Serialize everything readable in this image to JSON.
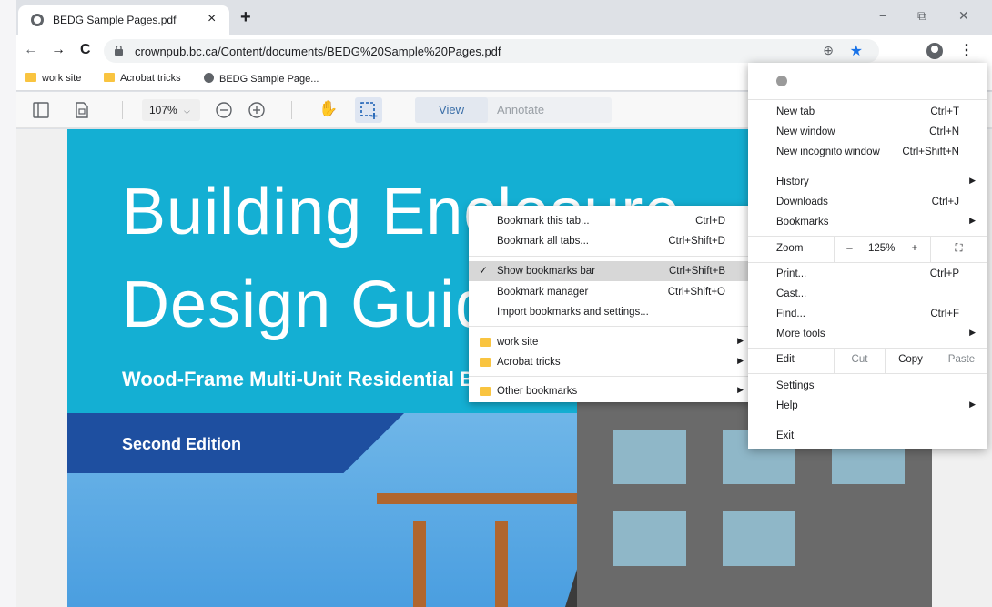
{
  "browser": {
    "tab_title": "BEDG Sample Pages.pdf",
    "tab_close": "×",
    "new_tab": "+",
    "window_controls": [
      "−",
      "⧉",
      "✕"
    ],
    "nav": {
      "back": "←",
      "forward": "→",
      "reload": "C"
    },
    "url": "crownpub.bc.ca/Content/documents/BEDG%20Sample%20Pages.pdf",
    "menu_dots": "⋮"
  },
  "bookmarks_bar": [
    {
      "label": "work site",
      "icon": "folder-icon"
    },
    {
      "label": "Acrobat tricks",
      "icon": "folder-icon"
    },
    {
      "label": "BEDG Sample Page...",
      "icon": "globe-icon"
    }
  ],
  "pdf_toolbar": {
    "zoom_value": "107",
    "zoom_unit": "%",
    "view_label": "View",
    "annotate_label": "Annotate"
  },
  "document": {
    "headline_1": "Building Enclosure",
    "headline_2": "Design Guide",
    "subtitle": "Wood-Frame Multi-Unit Residential Buildings",
    "edition": "Second Edition"
  },
  "bookmarks_menu": {
    "items": [
      {
        "label": "Bookmark this tab...",
        "shortcut": "Ctrl+D"
      },
      {
        "label": "Bookmark all tabs...",
        "shortcut": "Ctrl+Shift+D"
      },
      {
        "label": "Show bookmarks bar",
        "shortcut": "Ctrl+Shift+B",
        "checked": true
      },
      {
        "label": "Bookmark manager",
        "shortcut": "Ctrl+Shift+O"
      },
      {
        "label": "Import bookmarks and settings...",
        "shortcut": ""
      }
    ],
    "folders": [
      {
        "label": "work site"
      },
      {
        "label": "Acrobat tricks"
      }
    ],
    "other": {
      "label": "Other bookmarks"
    }
  },
  "chrome_menu": {
    "new_tab": {
      "label": "New tab",
      "shortcut": "Ctrl+T"
    },
    "new_window": {
      "label": "New window",
      "shortcut": "Ctrl+N"
    },
    "new_incognito": {
      "label": "New incognito window",
      "shortcut": "Ctrl+Shift+N"
    },
    "history": {
      "label": "History"
    },
    "downloads": {
      "label": "Downloads",
      "shortcut": "Ctrl+J"
    },
    "bookmarks": {
      "label": "Bookmarks"
    },
    "zoom": {
      "label": "Zoom",
      "minus": "–",
      "value": "125%",
      "plus": "+"
    },
    "print": {
      "label": "Print...",
      "shortcut": "Ctrl+P"
    },
    "cast": {
      "label": "Cast..."
    },
    "find": {
      "label": "Find...",
      "shortcut": "Ctrl+F"
    },
    "more_tools": {
      "label": "More tools"
    },
    "edit": {
      "label": "Edit",
      "cut": "Cut",
      "copy": "Copy",
      "paste": "Paste"
    },
    "settings": {
      "label": "Settings"
    },
    "help": {
      "label": "Help"
    },
    "exit": {
      "label": "Exit"
    }
  }
}
